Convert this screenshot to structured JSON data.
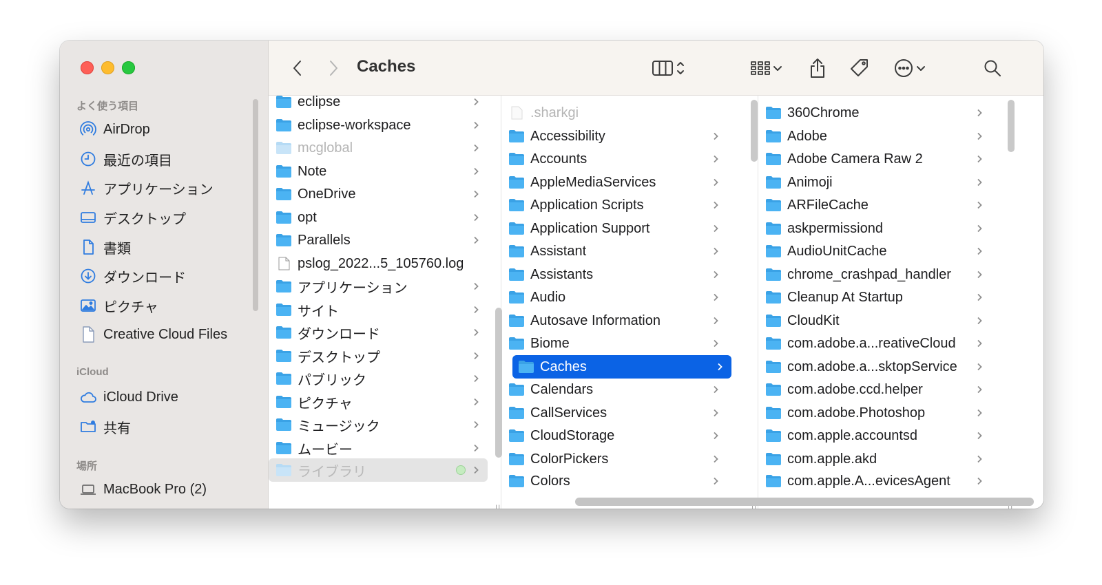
{
  "window": {
    "title": "Caches"
  },
  "sidebar": {
    "sections": [
      {
        "label": "よく使う項目",
        "items": [
          {
            "label": "AirDrop",
            "icon": "airdrop-icon"
          },
          {
            "label": "最近の項目",
            "icon": "clock-icon"
          },
          {
            "label": "アプリケーション",
            "icon": "applications-icon"
          },
          {
            "label": "デスクトップ",
            "icon": "desktop-icon"
          },
          {
            "label": "書類",
            "icon": "document-icon"
          },
          {
            "label": "ダウンロード",
            "icon": "download-icon"
          },
          {
            "label": "ピクチャ",
            "icon": "photo-icon"
          },
          {
            "label": "Creative Cloud Files",
            "icon": "file-icon"
          }
        ]
      },
      {
        "label": "iCloud",
        "items": [
          {
            "label": "iCloud Drive",
            "icon": "cloud-icon"
          },
          {
            "label": "共有",
            "icon": "shared-folder-icon"
          }
        ]
      },
      {
        "label": "場所",
        "items": [
          {
            "label": "MacBook Pro (2)",
            "icon": "laptop-icon"
          }
        ]
      }
    ]
  },
  "columns": [
    {
      "items": [
        {
          "name": "eclipse",
          "icon": "folder",
          "chevron": true
        },
        {
          "name": "eclipse-workspace",
          "icon": "folder",
          "chevron": true
        },
        {
          "name": "mcglobal",
          "icon": "folder",
          "chevron": true,
          "dim": true
        },
        {
          "name": "Note",
          "icon": "folder",
          "chevron": true
        },
        {
          "name": "OneDrive",
          "icon": "folder",
          "chevron": true
        },
        {
          "name": "opt",
          "icon": "folder",
          "chevron": true
        },
        {
          "name": "Parallels",
          "icon": "folder",
          "chevron": true
        },
        {
          "name": "pslog_2022...5_105760.log",
          "icon": "log",
          "chevron": false
        },
        {
          "name": "アプリケーション",
          "icon": "folder",
          "chevron": true
        },
        {
          "name": "サイト",
          "icon": "folder",
          "chevron": true
        },
        {
          "name": "ダウンロード",
          "icon": "folder",
          "chevron": true
        },
        {
          "name": "デスクトップ",
          "icon": "folder",
          "chevron": true
        },
        {
          "name": "パブリック",
          "icon": "folder",
          "chevron": true
        },
        {
          "name": "ピクチャ",
          "icon": "folder",
          "chevron": true
        },
        {
          "name": "ミュージック",
          "icon": "folder",
          "chevron": true
        },
        {
          "name": "ムービー",
          "icon": "folder",
          "chevron": true
        },
        {
          "name": "ライブラリ",
          "icon": "folder",
          "chevron": true,
          "hover": true,
          "tag": true
        }
      ]
    },
    {
      "items": [
        {
          "name": ".sharkgi",
          "icon": "blank",
          "chevron": false,
          "dim": true
        },
        {
          "name": "Accessibility",
          "icon": "folder",
          "chevron": true
        },
        {
          "name": "Accounts",
          "icon": "folder",
          "chevron": true
        },
        {
          "name": "AppleMediaServices",
          "icon": "folder",
          "chevron": true
        },
        {
          "name": "Application Scripts",
          "icon": "folder",
          "chevron": true
        },
        {
          "name": "Application Support",
          "icon": "folder",
          "chevron": true
        },
        {
          "name": "Assistant",
          "icon": "folder",
          "chevron": true
        },
        {
          "name": "Assistants",
          "icon": "folder",
          "chevron": true
        },
        {
          "name": "Audio",
          "icon": "folder",
          "chevron": true
        },
        {
          "name": "Autosave Information",
          "icon": "folder",
          "chevron": true
        },
        {
          "name": "Biome",
          "icon": "folder",
          "chevron": true
        },
        {
          "name": "Caches",
          "icon": "folder",
          "chevron": true,
          "selected": true
        },
        {
          "name": "Calendars",
          "icon": "folder",
          "chevron": true
        },
        {
          "name": "CallServices",
          "icon": "folder",
          "chevron": true
        },
        {
          "name": "CloudStorage",
          "icon": "folder",
          "chevron": true
        },
        {
          "name": "ColorPickers",
          "icon": "folder",
          "chevron": true
        },
        {
          "name": "Colors",
          "icon": "folder",
          "chevron": true
        }
      ]
    },
    {
      "items": [
        {
          "name": "360Chrome",
          "icon": "folder",
          "chevron": true
        },
        {
          "name": "Adobe",
          "icon": "folder",
          "chevron": true
        },
        {
          "name": "Adobe Camera Raw 2",
          "icon": "folder",
          "chevron": true
        },
        {
          "name": "Animoji",
          "icon": "folder",
          "chevron": true
        },
        {
          "name": "ARFileCache",
          "icon": "folder",
          "chevron": true
        },
        {
          "name": "askpermissiond",
          "icon": "folder",
          "chevron": true
        },
        {
          "name": "AudioUnitCache",
          "icon": "folder",
          "chevron": true
        },
        {
          "name": "chrome_crashpad_handler",
          "icon": "folder",
          "chevron": true
        },
        {
          "name": "Cleanup At Startup",
          "icon": "folder",
          "chevron": true
        },
        {
          "name": "CloudKit",
          "icon": "folder",
          "chevron": true
        },
        {
          "name": "com.adobe.a...reativeCloud",
          "icon": "folder",
          "chevron": true
        },
        {
          "name": "com.adobe.a...sktopService",
          "icon": "folder",
          "chevron": true
        },
        {
          "name": "com.adobe.ccd.helper",
          "icon": "folder",
          "chevron": true
        },
        {
          "name": "com.adobe.Photoshop",
          "icon": "folder",
          "chevron": true
        },
        {
          "name": "com.apple.accountsd",
          "icon": "folder",
          "chevron": true
        },
        {
          "name": "com.apple.akd",
          "icon": "folder",
          "chevron": true
        },
        {
          "name": "com.apple.A...evicesAgent",
          "icon": "folder",
          "chevron": true
        }
      ]
    }
  ],
  "colors": {
    "accent": "#0b63e5",
    "folder": "#4bb3f3",
    "sidebar_icon": "#2f7ce0"
  }
}
